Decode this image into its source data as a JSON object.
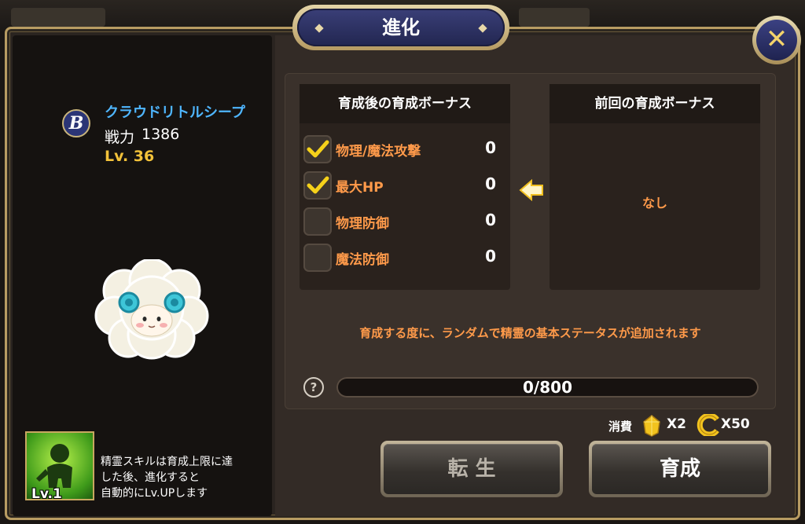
{
  "window": {
    "title": "進化",
    "close_label": "✕"
  },
  "colors": {
    "frame_gold": "#b89c62",
    "title_navy": "#2c3268",
    "stat_orange": "#ff9a4a",
    "name_blue": "#4fb6ff",
    "level_yellow": "#f3c23a"
  },
  "spirit": {
    "grade": "B",
    "name": "クラウドリトルシープ",
    "power_label": "戦力",
    "power": "1386",
    "level": "Lv. 36"
  },
  "skill": {
    "level": "Lv.1",
    "description": "精霊スキルは育成上限に達\nした後、進化すると\n自動的にLv.UPします"
  },
  "bonus_after": {
    "title": "育成後の育成ボーナス",
    "stats": [
      {
        "label": "物理/魔法攻撃",
        "value": "0",
        "checked": true
      },
      {
        "label": "最大HP",
        "value": "0",
        "checked": true
      },
      {
        "label": "物理防御",
        "value": "0",
        "checked": false
      },
      {
        "label": "魔法防御",
        "value": "0",
        "checked": false
      }
    ]
  },
  "bonus_before": {
    "title": "前回の育成ボーナス",
    "empty_text": "なし"
  },
  "info_text": "育成する度に、ランダムで精霊の基本ステータスが追加されます",
  "progress": {
    "text": "0/800",
    "current": 0,
    "max": 800,
    "help_label": "?"
  },
  "cost": {
    "label": "消費",
    "gem_count": "X2",
    "coin_count": "X50"
  },
  "buttons": {
    "reincarnate": "転 生",
    "train": "育成"
  }
}
